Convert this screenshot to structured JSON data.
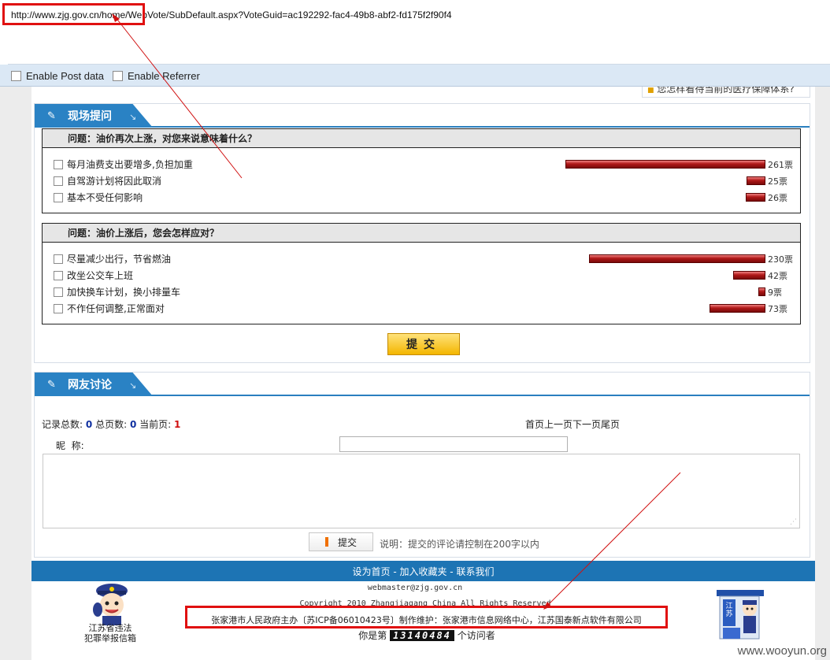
{
  "browser": {
    "url": "http://www.zjg.gov.cn/home/WebVote/SubDefault.aspx?VoteGuid=ac192292-fac4-49b8-abf2-fd175f2f90f4",
    "enable_post": "Enable Post data",
    "enable_referrer": "Enable Referrer"
  },
  "top_link": "您怎样看待当前的医疗保障体系?",
  "section1": {
    "title": "现场提问",
    "polls": [
      {
        "question": "问题：油价再次上涨，对您来说意味着什么？",
        "options": [
          {
            "label": "每月油费支出要增多,负担加重",
            "count": "261票",
            "votes": 261
          },
          {
            "label": "自驾游计划将因此取消",
            "count": "25票",
            "votes": 25
          },
          {
            "label": "基本不受任何影响",
            "count": "26票",
            "votes": 26
          }
        ]
      },
      {
        "question": "问题：油价上涨后，您会怎样应对？",
        "options": [
          {
            "label": "尽量减少出行，节省燃油",
            "count": "230票",
            "votes": 230
          },
          {
            "label": "改坐公交车上班",
            "count": "42票",
            "votes": 42
          },
          {
            "label": "加快换车计划，换小排量车",
            "count": "9票",
            "votes": 9
          },
          {
            "label": "不作任何调整,正常面对",
            "count": "73票",
            "votes": 73
          }
        ]
      }
    ],
    "submit": "提交"
  },
  "section2": {
    "title": "网友讨论",
    "stats": {
      "total_label": "记录总数:",
      "total": "0",
      "pages_label": "总页数:",
      "pages": "0",
      "current_label": "当前页:",
      "current": "1"
    },
    "pager": "首页上一页下一页尾页",
    "nick_label": "昵  称:",
    "submit": "提交",
    "note": "说明：提交的评论请控制在200字以内"
  },
  "footer": {
    "links": "设为首页 - 加入收藏夹 - 联系我们",
    "email": "webmaster@zjg.gov.cn",
    "copyright": "Copyright 2010 Zhangjiagang China All Rights Reserved",
    "host": "张家港市人民政府主办〔苏ICP备06010423号〕制作维护：张家港市信息网络中心，江苏国泰新点软件有限公司",
    "visit_prefix": "你是第",
    "visit_num": "13140484",
    "visit_suffix": "个访问者",
    "left_caption_1": "江苏省违法",
    "left_caption_2": "犯罪举报信箱",
    "right_sign": "江苏"
  },
  "watermark": "www.wooyun.org",
  "colors": {
    "accent": "#2a82c4",
    "bar": "#b01818",
    "highlight": "#e01010",
    "button": "#f3b600"
  }
}
